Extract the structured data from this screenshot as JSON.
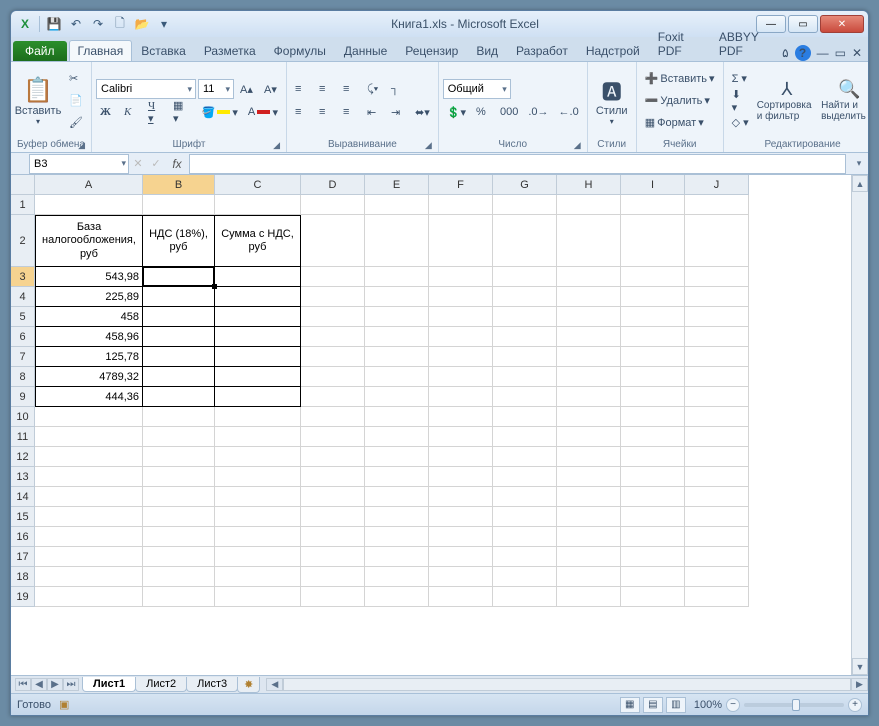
{
  "title": "Книга1.xls  -  Microsoft Excel",
  "qat": {
    "save": "💾",
    "undo": "↶",
    "redo": "↷",
    "new": "🗋",
    "open": "📂"
  },
  "tabs": {
    "file": "Файл",
    "list": [
      "Главная",
      "Вставка",
      "Разметка",
      "Формулы",
      "Данные",
      "Рецензир",
      "Вид",
      "Разработ",
      "Надстрой",
      "Foxit PDF",
      "ABBYY PDF"
    ],
    "active": 0
  },
  "ribbon": {
    "clipboard": {
      "paste": "Вставить",
      "label": "Буфер обмена"
    },
    "font": {
      "name": "Calibri",
      "size": "11",
      "label": "Шрифт"
    },
    "align": {
      "label": "Выравнивание"
    },
    "number": {
      "format": "Общий",
      "label": "Число"
    },
    "styles": {
      "btn": "Стили",
      "label": "Стили"
    },
    "cells": {
      "insert": "Вставить",
      "delete": "Удалить",
      "format": "Формат",
      "label": "Ячейки"
    },
    "editing": {
      "sort": "Сортировка и фильтр",
      "find": "Найти и выделить",
      "label": "Редактирование"
    }
  },
  "namebox": "B3",
  "columns": [
    "A",
    "B",
    "C",
    "D",
    "E",
    "F",
    "G",
    "H",
    "I",
    "J"
  ],
  "col_widths": [
    "wA",
    "wB",
    "wC",
    "wN",
    "wN",
    "wN",
    "wN",
    "wN",
    "wN",
    "wN"
  ],
  "rows": [
    1,
    2,
    3,
    4,
    5,
    6,
    7,
    8,
    9,
    10,
    11,
    12,
    13,
    14,
    15,
    16,
    17,
    18,
    19
  ],
  "table": {
    "headers": [
      "База налогообложения, руб",
      "НДС (18%), руб",
      "Сумма с НДС, руб"
    ],
    "values_A": [
      "543,98",
      "225,89",
      "458",
      "458,96",
      "125,78",
      "4789,32",
      "444,36"
    ]
  },
  "selected": {
    "row": 3,
    "col": "B"
  },
  "sheets": {
    "list": [
      "Лист1",
      "Лист2",
      "Лист3"
    ],
    "active": 0
  },
  "status": {
    "ready": "Готово",
    "zoom": "100%"
  }
}
